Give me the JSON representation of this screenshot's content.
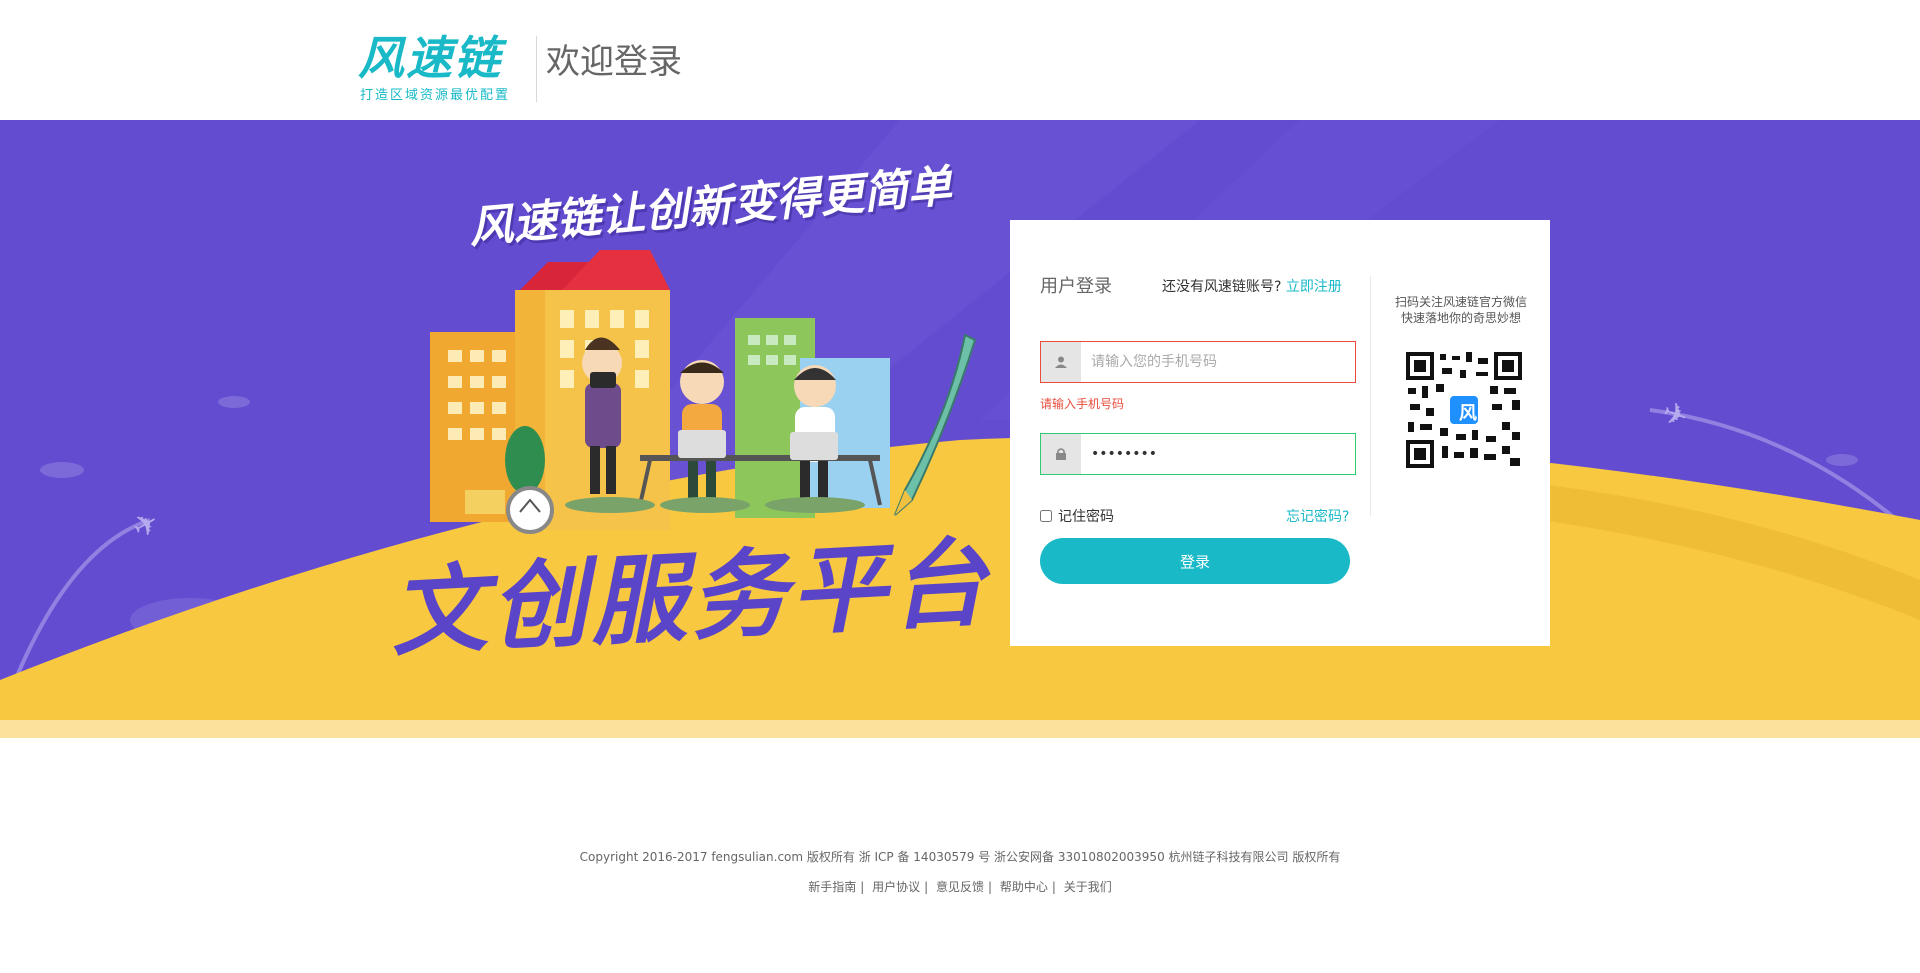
{
  "header": {
    "logo_text": "风速链",
    "logo_tagline": "打造区域资源最优配置",
    "title": "欢迎登录"
  },
  "banner": {
    "slogan": "风速链让创新变得更简单",
    "platform_title": "文创服务平台"
  },
  "login": {
    "title": "用户登录",
    "no_account_text": "还没有风速链账号?",
    "register_link": "立即注册",
    "phone_placeholder": "请输入您的手机号码",
    "phone_value": "",
    "phone_error": "请输入手机号码",
    "password_value": "••••••••",
    "remember_label": "记住密码",
    "forgot_link": "忘记密码?",
    "login_button": "登录",
    "qr_text_line1": "扫码关注风速链官方微信",
    "qr_text_line2": "快速落地你的奇思妙想",
    "qr_center_char": "风"
  },
  "footer": {
    "copyright": "Copyright 2016-2017 fengsulian.com 版权所有 浙 ICP 备 14030579 号 浙公安网备 33010802003950     杭州链子科技有限公司   版权所有",
    "links": [
      "新手指南",
      "用户协议",
      "意见反馈",
      "帮助中心",
      "关于我们"
    ]
  },
  "colors": {
    "accent": "#19b9c8",
    "banner_purple": "#634cd0",
    "banner_yellow": "#f8c840",
    "error": "#e74c3c",
    "success": "#2ecc71"
  }
}
